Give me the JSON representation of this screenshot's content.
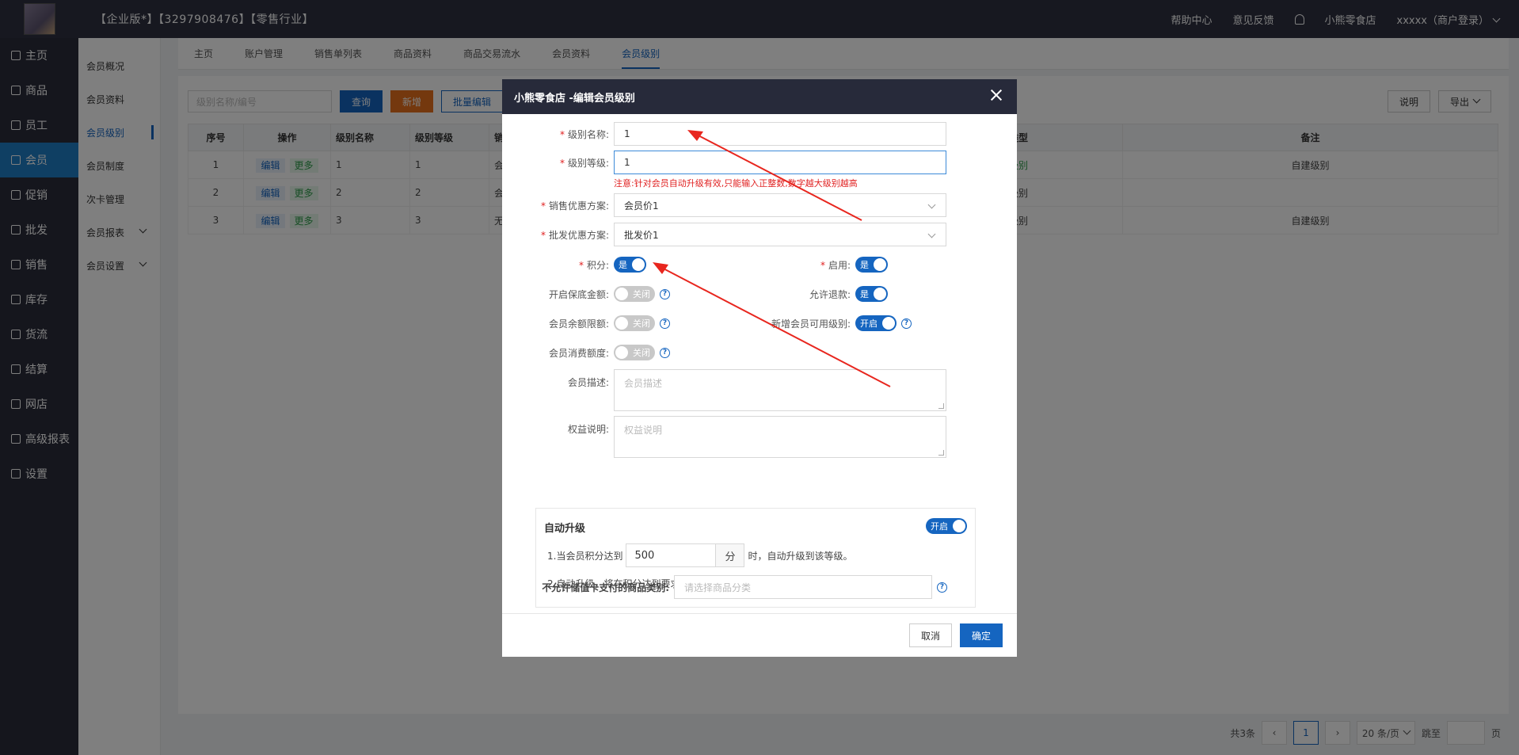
{
  "topbar": {
    "title": "【企业版*】【3297908476】【零售行业】",
    "help": "帮助中心",
    "feedback": "意见反馈",
    "shop": "小熊零食店",
    "user": "xxxxx（商户登录）"
  },
  "sidebar": {
    "items": [
      {
        "label": "主页",
        "icon": "home-icon"
      },
      {
        "label": "商品",
        "icon": "goods-icon"
      },
      {
        "label": "员工",
        "icon": "staff-icon"
      },
      {
        "label": "会员",
        "icon": "member-icon"
      },
      {
        "label": "促销",
        "icon": "promotion-icon"
      },
      {
        "label": "批发",
        "icon": "wholesale-icon"
      },
      {
        "label": "销售",
        "icon": "sales-icon"
      },
      {
        "label": "库存",
        "icon": "stock-icon"
      },
      {
        "label": "货流",
        "icon": "logistics-icon"
      },
      {
        "label": "结算",
        "icon": "settle-icon"
      },
      {
        "label": "网店",
        "icon": "store-icon"
      },
      {
        "label": "高级报表",
        "icon": "report-icon"
      },
      {
        "label": "设置",
        "icon": "settings-icon"
      }
    ]
  },
  "subnav": {
    "items": [
      "会员概况",
      "会员资料",
      "会员级别",
      "会员制度",
      "次卡管理",
      "会员报表",
      "会员设置"
    ]
  },
  "tabs": [
    "主页",
    "账户管理",
    "销售单列表",
    "商品资料",
    "商品交易流水",
    "会员资料",
    "会员级别"
  ],
  "toolbar": {
    "search_placeholder": "级别名称/编号",
    "query": "查询",
    "add": "新增",
    "batch_edit": "批量编辑",
    "explain": "说明",
    "export": "导出"
  },
  "table": {
    "headers": [
      "序号",
      "操作",
      "级别名称",
      "级别等级",
      "销",
      "类型",
      "备注"
    ],
    "edit": "编辑",
    "more": "更多",
    "rows": [
      {
        "no": "1",
        "name": "1",
        "level": "1",
        "sale": "会",
        "type": "级别",
        "remark": "自建级别"
      },
      {
        "no": "2",
        "name": "2",
        "level": "2",
        "sale": "会",
        "type": "级别",
        "remark": ""
      },
      {
        "no": "3",
        "name": "3",
        "level": "3",
        "sale": "无",
        "type": "级别",
        "remark": "自建级别"
      }
    ]
  },
  "pager": {
    "total": "共3条",
    "current": "1",
    "page_size": "20 条/页",
    "jump": "跳至",
    "page_unit": "页"
  },
  "modal": {
    "title": "小熊零食店 -编辑会员级别",
    "level_name_label": "级别名称:",
    "level_name_value": "1",
    "level_grade_label": "级别等级:",
    "level_grade_value": "1",
    "note": "注意:针对会员自动升级有效,只能输入正整数,数字越大级别越高",
    "sale_plan_label": "销售优惠方案:",
    "sale_plan_value": "会员价1",
    "wholesale_plan_label": "批发优惠方案:",
    "wholesale_plan_value": "批发价1",
    "points_label": "积分:",
    "points_state": "是",
    "enable_label": "启用:",
    "enable_state": "是",
    "min_amount_label": "开启保底金额:",
    "min_amount_state": "关闭",
    "refund_label": "允许退款:",
    "refund_state": "是",
    "balance_limit_label": "会员余额限额:",
    "balance_limit_state": "关闭",
    "new_member_label": "新增会员可用级别:",
    "new_member_state": "开启",
    "consume_label": "会员消费额度:",
    "consume_state": "关闭",
    "desc_label": "会员描述:",
    "desc_placeholder": "会员描述",
    "rights_label": "权益说明:",
    "rights_placeholder": "权益说明",
    "auto_title": "自动升级",
    "auto_state": "开启",
    "auto_line1_pre": "1.当会员积分达到",
    "auto_points": "500",
    "auto_unit": "分",
    "auto_line1_post": "时，自动升级到该等级。",
    "auto_line2": "2.自动升级，将在积分达到要求后的第二天生效。",
    "category_label": "不允许储值卡支付的商品类别:",
    "category_placeholder": "请选择商品分类",
    "cancel": "取消",
    "confirm": "确定"
  },
  "colors": {
    "accent": "#1565c0",
    "topbar": "#2e3040",
    "sidebar_active": "#1f7fc7",
    "warning": "#e02020",
    "annotation_arrow": "#e8261e"
  }
}
